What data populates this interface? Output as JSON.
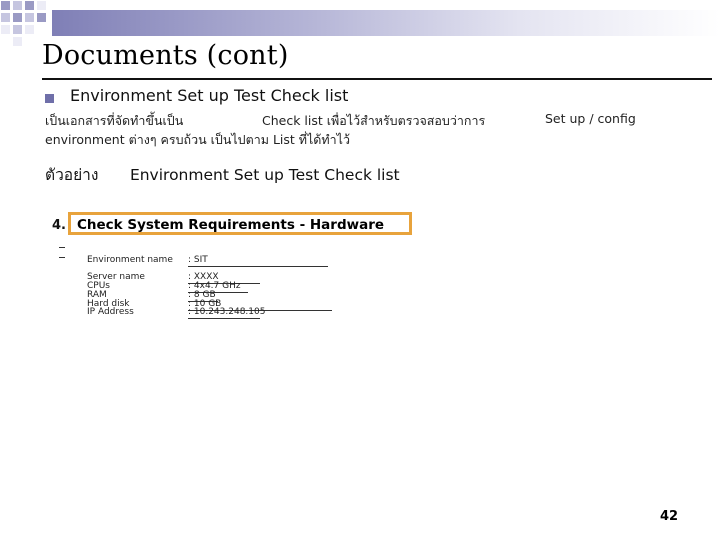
{
  "slide": {
    "title": "Documents (cont)",
    "heading": "Environment Set up Test Check list",
    "desc_line1_a": "เป็นเอกสารที่จัดทำขึ้นเป็น",
    "desc_line1_b": "Check list เพื่อไว้สำหรับตรวจสอบว่าการ",
    "desc_line1_c": "Set up / config",
    "desc_line2": "environment ต่างๆ ครบถ้วน เป็นไปตาม List ที่ได้ทำไว้",
    "example_label": "ตัวอย่าง",
    "example_text": "Environment Set up Test Check list",
    "page_number": "42"
  },
  "requirements": {
    "number": "4.",
    "title": "Check System Requirements - Hardware",
    "environment": {
      "label": "Environment name",
      "value": ": SIT"
    },
    "fields": [
      {
        "label": "Server name",
        "value": ": XXXX"
      },
      {
        "label": "CPUs",
        "value": ": 4x4.7 GHz"
      },
      {
        "label": "RAM",
        "value": ": 8 GB"
      },
      {
        "label": "Hard disk",
        "value": ": 10 GB"
      },
      {
        "label": "IP Address",
        "value": ": 10.243.248.105"
      }
    ]
  },
  "colors": {
    "highlight_border": "#e8a33c",
    "bullet": "#6f6fa9",
    "header_band": "#7f7fb6"
  }
}
